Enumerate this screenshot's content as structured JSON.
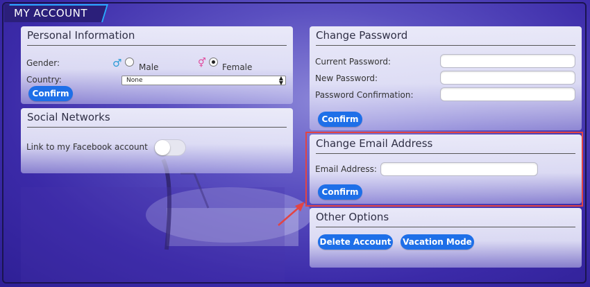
{
  "tab": {
    "title": "MY ACCOUNT"
  },
  "personal": {
    "title": "Personal Information",
    "gender_label": "Gender:",
    "male_label": "Male",
    "female_label": "Female",
    "gender_selected": "Female",
    "country_label": "Country:",
    "country_value": "None",
    "confirm_label": "Confirm",
    "male_icon": "♂",
    "female_icon": "⚥"
  },
  "social": {
    "title": "Social Networks",
    "facebook_label": "Link to my Facebook account",
    "facebook_enabled": false
  },
  "password": {
    "title": "Change Password",
    "current_label": "Current Password:",
    "new_label": "New Password:",
    "confirm_field_label": "Password Confirmation:",
    "confirm_label": "Confirm"
  },
  "email": {
    "title": "Change Email Address",
    "address_label": "Email Address:",
    "confirm_label": "Confirm"
  },
  "other": {
    "title": "Other Options",
    "delete_label": "Delete Account",
    "vacation_label": "Vacation Mode"
  },
  "colors": {
    "accent": "#1e6fe8",
    "highlight": "#e24444",
    "tab_bg": "#2b1f7a"
  }
}
